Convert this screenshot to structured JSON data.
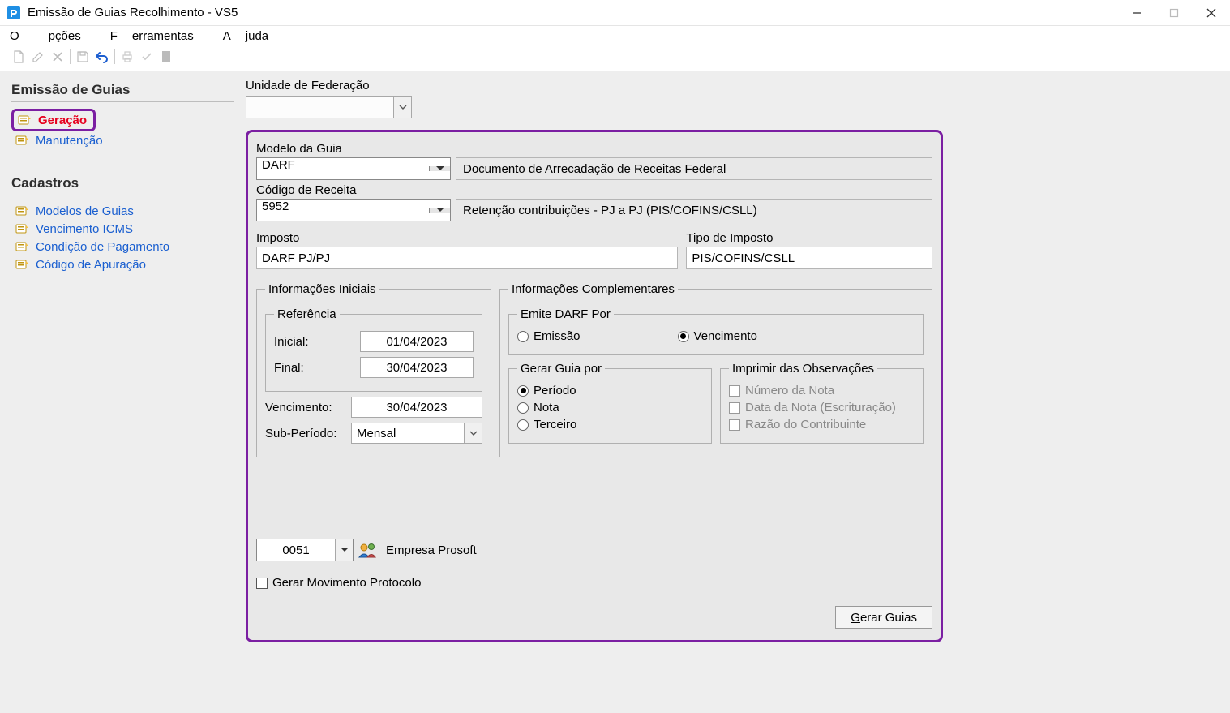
{
  "window": {
    "title": "Emissão de Guias Recolhimento - VS5"
  },
  "menu": {
    "opcoes": "Opções",
    "ferramentas": "Ferramentas",
    "ajuda": "Ajuda"
  },
  "sidebar": {
    "section1_title": "Emissão de Guias",
    "items1": [
      {
        "label": "Geração"
      },
      {
        "label": "Manutenção"
      }
    ],
    "section2_title": "Cadastros",
    "items2": [
      {
        "label": "Modelos de Guias"
      },
      {
        "label": "Vencimento ICMS"
      },
      {
        "label": "Condição de Pagamento"
      },
      {
        "label": "Código de Apuração"
      }
    ]
  },
  "form": {
    "uf_label": "Unidade de Federação",
    "uf_value": "",
    "modelo_label": "Modelo da Guia",
    "modelo_value": "DARF",
    "modelo_desc": "Documento de Arrecadação de Receitas Federal",
    "codigo_label": "Código de Receita",
    "codigo_value": "5952",
    "codigo_desc": "Retenção contribuições - PJ a PJ (PIS/COFINS/CSLL)",
    "imposto_label": "Imposto",
    "imposto_value": "DARF PJ/PJ",
    "tipo_imposto_label": "Tipo de Imposto",
    "tipo_imposto_value": "PIS/COFINS/CSLL",
    "iniciais": {
      "legend": "Informações Iniciais",
      "referencia_legend": "Referência",
      "inicial_label": "Inicial:",
      "inicial": "01/04/2023",
      "final_label": "Final:",
      "final": "30/04/2023",
      "venc_label": "Vencimento:",
      "venc": "30/04/2023",
      "sub_label": "Sub-Período:",
      "sub": "Mensal"
    },
    "complementares": {
      "legend": "Informações Complementares",
      "emite_legend": "Emite DARF Por",
      "emissao": "Emissão",
      "vencimento": "Vencimento",
      "gerar_legend": "Gerar Guia por",
      "periodo": "Período",
      "nota": "Nota",
      "terceiro": "Terceiro",
      "obs_legend": "Imprimir das Observações",
      "numero_nota": "Número da Nota",
      "data_nota": "Data da Nota (Escrituração)",
      "razao": "Razão do Contribuinte"
    },
    "company_code": "0051",
    "company_name": "Empresa Prosoft",
    "gerar_mov": "Gerar Movimento Protocolo",
    "gerar_btn": "Gerar Guias"
  }
}
